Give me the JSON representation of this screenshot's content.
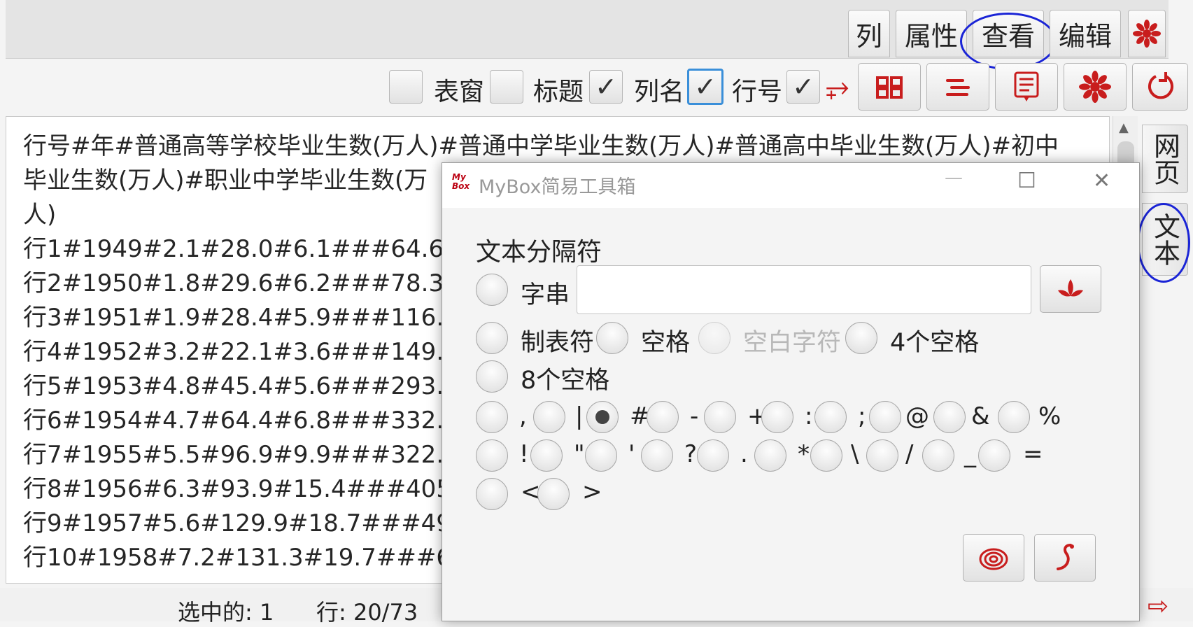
{
  "tabs": {
    "col": "列",
    "props": "属性",
    "view": "查看",
    "edit": "编辑",
    "icon": "flower-icon"
  },
  "toolbar": {
    "form_window": "表窗",
    "title": "标题",
    "column_names": "列名",
    "row_number": "行号",
    "checks": {
      "form_window": false,
      "title": false,
      "column_names": true,
      "row_number": true
    },
    "check_glyph": "✓",
    "wrap_glyph": "⥅",
    "buttons": [
      "pattern-icon",
      "stream-icon",
      "notes-icon",
      "flower-icon",
      "refresh-icon"
    ]
  },
  "text_lines": [
    "行号#年#普通高等学校毕业生数(万人)#普通中学毕业生数(万人)#普通高中毕业生数(万人)#初中",
    "毕业生数(万人)#职业中学毕业生数(万",
    "人)",
    "行1#1949#2.1#28.0#6.1###64.6#",
    "行2#1950#1.8#29.6#6.2###78.3#",
    "行3#1951#1.9#28.4#5.9###116.6#",
    "行4#1952#3.2#22.1#3.6###149.0#",
    "行5#1953#4.8#45.4#5.6###293.5#",
    "行6#1954#4.7#64.4#6.8###332.5#(",
    "行7#1955#5.5#96.9#9.9###322.9#(",
    "行8#1956#6.3#93.9#15.4###405.1#",
    "行9#1957#5.6#129.9#18.7###498.(",
    "行10#1958#7.2#131.3#19.7###606"
  ],
  "side_tabs": {
    "web": "网页",
    "text": "文本"
  },
  "status": {
    "selected": "选中的: 1",
    "rows": "行: 20/73"
  },
  "dialog": {
    "app_title": "MyBox简易工具箱",
    "logo_text": "My Box",
    "win_min": "—",
    "win_max": "☐",
    "win_close": "✕",
    "heading": "文本分隔符",
    "string_label": "字串",
    "string_value": "",
    "options_row1": [
      "制表符",
      "空格",
      "空白字符",
      "4个空格"
    ],
    "options_row2": [
      "8个空格"
    ],
    "symbols_row1": [
      ",",
      "|",
      "#",
      "-",
      "+",
      ":",
      ";",
      "@",
      "&",
      "%"
    ],
    "symbols_row2": [
      "!",
      "\"",
      "'",
      "?",
      ".",
      "*",
      "\\",
      "/",
      "_",
      "="
    ],
    "symbols_row3": [
      "<",
      ">"
    ],
    "selected_symbol": "#",
    "buttons": [
      "swirl-icon",
      "return-icon"
    ]
  }
}
